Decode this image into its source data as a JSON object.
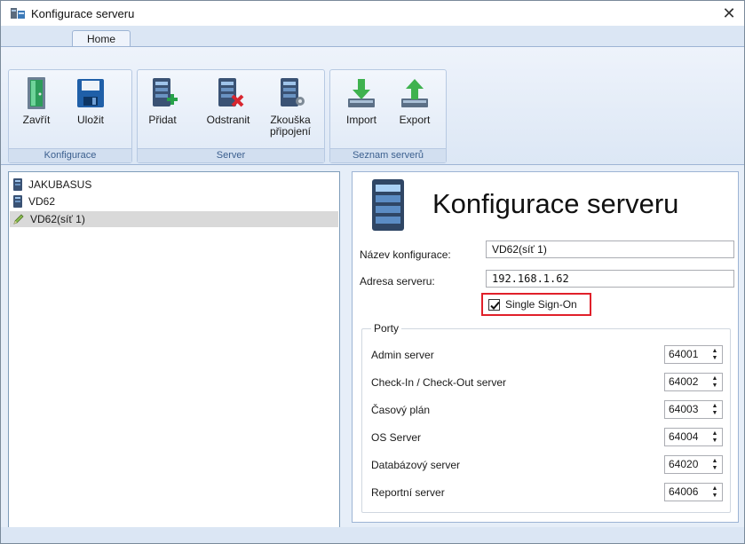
{
  "window": {
    "title": "Konfigurace serveru",
    "close_glyph": "✕"
  },
  "tabs": [
    {
      "label": "Home",
      "selected": true
    }
  ],
  "ribbon": {
    "groups": [
      {
        "label": "Konfigurace",
        "buttons": [
          {
            "label": "Zavřít",
            "icon": "door-icon"
          },
          {
            "label": "Uložit",
            "icon": "floppy-disk-icon"
          }
        ]
      },
      {
        "label": "Server",
        "buttons": [
          {
            "label": "Přidat",
            "icon": "server-add-icon"
          },
          {
            "label": "Odstranit",
            "icon": "server-remove-icon"
          },
          {
            "label": "Zkouška",
            "label2": "připojení",
            "icon": "server-test-icon"
          }
        ]
      },
      {
        "label": "Seznam serverů",
        "buttons": [
          {
            "label": "Import",
            "icon": "import-arrow-icon"
          },
          {
            "label": "Export",
            "icon": "export-arrow-icon"
          }
        ]
      }
    ]
  },
  "tree": {
    "items": [
      {
        "label": "JAKUBASUS",
        "icon": "server-icon",
        "selected": false
      },
      {
        "label": "VD62",
        "icon": "server-icon",
        "selected": false
      },
      {
        "label": "VD62(síť 1)",
        "icon": "pencil-icon",
        "selected": true
      }
    ]
  },
  "detail": {
    "heading": "Konfigurace serveru",
    "config_name_label": "Název konfigurace:",
    "config_name_value": "VD62(síť 1)",
    "address_label": "Adresa serveru:",
    "address_value": "192.168.1.62",
    "sso_label": "Single Sign-On",
    "sso_checked": true,
    "ports_legend": "Porty",
    "ports": [
      {
        "label": "Admin server",
        "value": "64001"
      },
      {
        "label": "Check-In / Check-Out server",
        "value": "64002"
      },
      {
        "label": "Časový plán",
        "value": "64003"
      },
      {
        "label": "OS Server",
        "value": "64004"
      },
      {
        "label": "Databázový server",
        "value": "64020"
      },
      {
        "label": "Reportní server",
        "value": "64006"
      }
    ]
  },
  "colors": {
    "highlight_border": "#e0202a",
    "ribbon_label": "#3b5f8e",
    "window_bg": "#e6eef8"
  }
}
